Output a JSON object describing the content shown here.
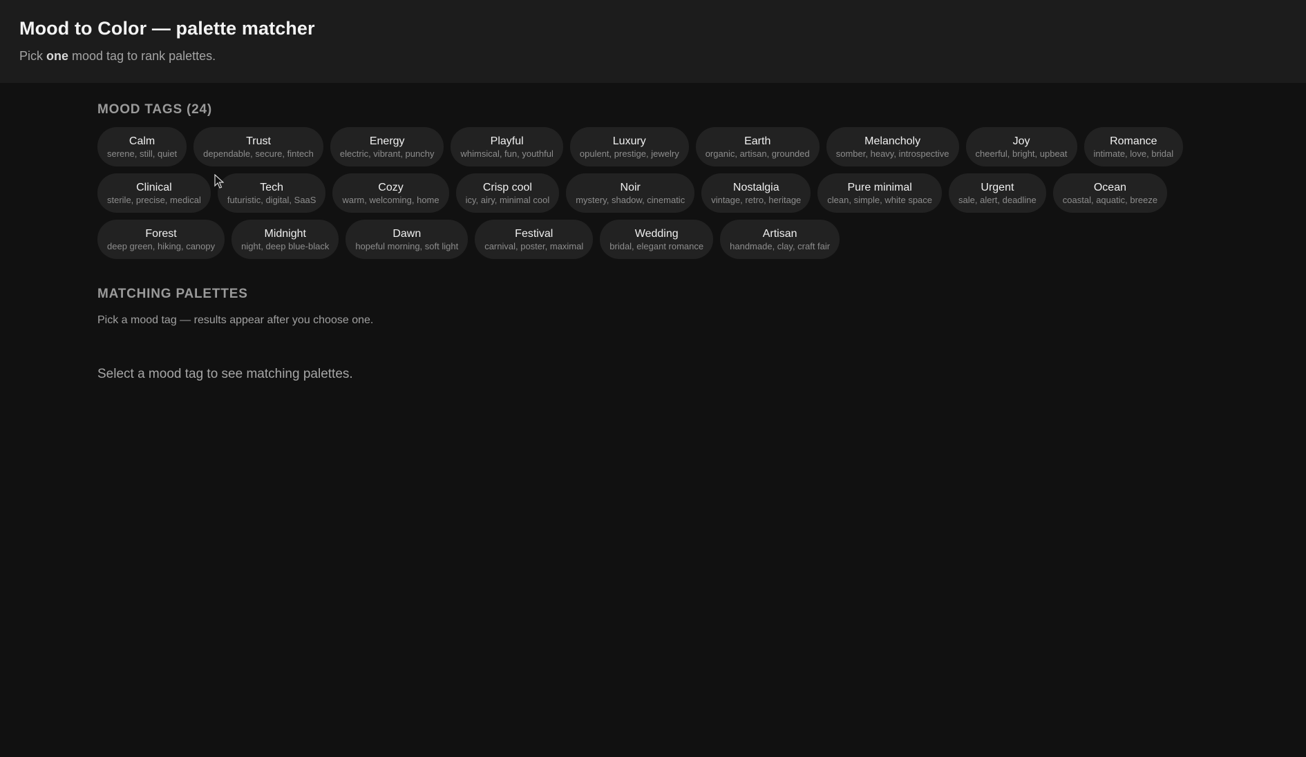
{
  "header": {
    "title": "Mood to Color — palette matcher",
    "subtitle_before": "Pick ",
    "subtitle_bold": "one",
    "subtitle_after": " mood tag to rank palettes."
  },
  "mood_tags": {
    "heading": "MOOD TAGS (24)",
    "items": [
      {
        "name": "Calm",
        "desc": "serene, still, quiet"
      },
      {
        "name": "Trust",
        "desc": "dependable, secure, fintech"
      },
      {
        "name": "Energy",
        "desc": "electric, vibrant, punchy"
      },
      {
        "name": "Playful",
        "desc": "whimsical, fun, youthful"
      },
      {
        "name": "Luxury",
        "desc": "opulent, prestige, jewelry"
      },
      {
        "name": "Earth",
        "desc": "organic, artisan, grounded"
      },
      {
        "name": "Melancholy",
        "desc": "somber, heavy, introspective"
      },
      {
        "name": "Joy",
        "desc": "cheerful, bright, upbeat"
      },
      {
        "name": "Romance",
        "desc": "intimate, love, bridal"
      },
      {
        "name": "Clinical",
        "desc": "sterile, precise, medical"
      },
      {
        "name": "Tech",
        "desc": "futuristic, digital, SaaS"
      },
      {
        "name": "Cozy",
        "desc": "warm, welcoming, home"
      },
      {
        "name": "Crisp cool",
        "desc": "icy, airy, minimal cool"
      },
      {
        "name": "Noir",
        "desc": "mystery, shadow, cinematic"
      },
      {
        "name": "Nostalgia",
        "desc": "vintage, retro, heritage"
      },
      {
        "name": "Pure minimal",
        "desc": "clean, simple, white space"
      },
      {
        "name": "Urgent",
        "desc": "sale, alert, deadline"
      },
      {
        "name": "Ocean",
        "desc": "coastal, aquatic, breeze"
      },
      {
        "name": "Forest",
        "desc": "deep green, hiking, canopy"
      },
      {
        "name": "Midnight",
        "desc": "night, deep blue-black"
      },
      {
        "name": "Dawn",
        "desc": "hopeful morning, soft light"
      },
      {
        "name": "Festival",
        "desc": "carnival, poster, maximal"
      },
      {
        "name": "Wedding",
        "desc": "bridal, elegant romance"
      },
      {
        "name": "Artisan",
        "desc": "handmade, clay, craft fair"
      }
    ]
  },
  "palettes": {
    "heading": "MATCHING PALETTES",
    "hint": "Pick a mood tag — results appear after you choose one.",
    "empty_state": "Select a mood tag to see matching palettes."
  },
  "colors": {
    "background": "#111111",
    "header_background": "#1c1c1c",
    "tag_background": "#222222"
  }
}
